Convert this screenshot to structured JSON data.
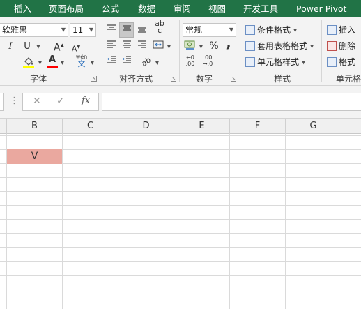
{
  "tabs": [
    {
      "label": "插入"
    },
    {
      "label": "页面布局"
    },
    {
      "label": "公式"
    },
    {
      "label": "数据"
    },
    {
      "label": "审阅"
    },
    {
      "label": "视图"
    },
    {
      "label": "开发工具"
    },
    {
      "label": "Power Pivot"
    }
  ],
  "font_group": {
    "font_name": "软雅黑",
    "font_size": "11",
    "label": "字体",
    "italic": "I",
    "underline": "U",
    "grow": "A",
    "shrink": "A",
    "font_color": "A",
    "phonetic_top": "wén",
    "phonetic_bottom": "文"
  },
  "align_group": {
    "label": "对齐方式",
    "text_orientation_glyph": "ab c",
    "orientation": "ab"
  },
  "number_group": {
    "format": "常规",
    "label": "数字",
    "percent": "%",
    "comma": ",",
    "inc_decimal_top": "←0",
    "inc_decimal_bottom": ".00",
    "dec_decimal_top": ".00",
    "dec_decimal_bottom": "→.0"
  },
  "styles_group": {
    "conditional": "条件格式",
    "table": "套用表格格式",
    "cell_styles": "单元格样式",
    "label": "样式"
  },
  "cells_group": {
    "insert": "插入",
    "delete": "删除",
    "format": "格式",
    "label": "单元格"
  },
  "formula_bar": {
    "cancel": "✕",
    "enter": "✓",
    "fx": "fx",
    "value": ""
  },
  "columns": [
    "B",
    "C",
    "D",
    "E",
    "F",
    "G"
  ],
  "cell_b2": "V",
  "colors": {
    "tab_bar": "#217346",
    "highlight_cell": "#eaa89f",
    "font_color_bar": "#ff0000",
    "fill_color_bar": "#ffff00"
  }
}
